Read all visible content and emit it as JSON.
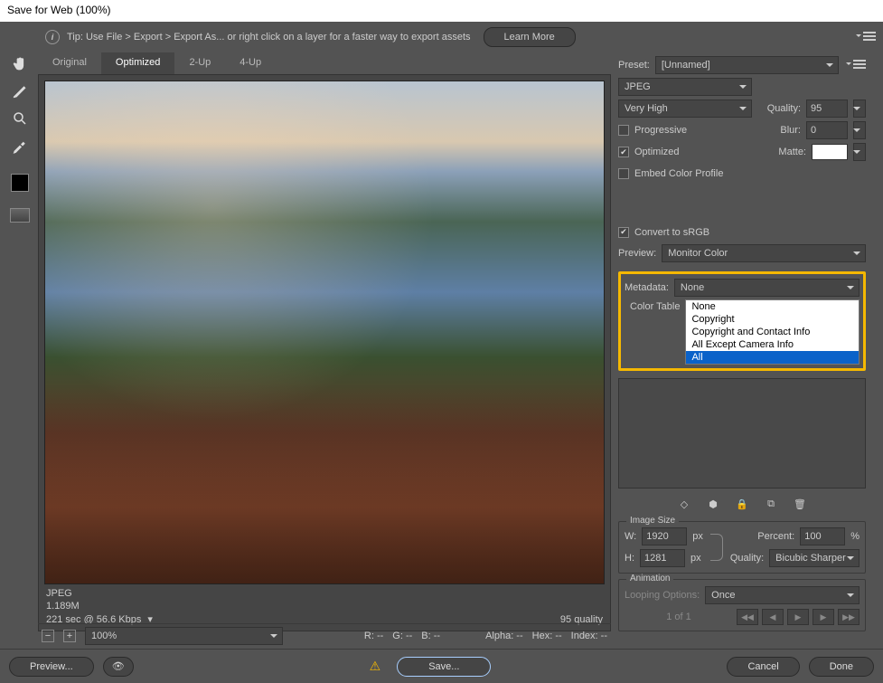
{
  "window": {
    "title": "Save for Web (100%)"
  },
  "tip": {
    "text": "Tip: Use File > Export > Export As...  or right click on a layer for a faster way to export assets",
    "learn": "Learn More"
  },
  "tabs": {
    "original": "Original",
    "optimized": "Optimized",
    "two_up": "2-Up",
    "four_up": "4-Up"
  },
  "preview_footer": {
    "format": "JPEG",
    "size": "1.189M",
    "time": "221 sec @ 56.6 Kbps",
    "quality": "95 quality"
  },
  "preset": {
    "label": "Preset:",
    "value": "[Unnamed]"
  },
  "format": {
    "value": "JPEG"
  },
  "compression": {
    "value": "Very High"
  },
  "quality": {
    "label": "Quality:",
    "value": "95"
  },
  "progressive": {
    "label": "Progressive"
  },
  "blur": {
    "label": "Blur:",
    "value": "0"
  },
  "optimized": {
    "label": "Optimized"
  },
  "matte": {
    "label": "Matte:"
  },
  "embed": {
    "label": "Embed Color Profile"
  },
  "convert": {
    "label": "Convert to sRGB"
  },
  "previewsel": {
    "label": "Preview:",
    "value": "Monitor Color"
  },
  "metadata": {
    "label": "Metadata:",
    "value": "None",
    "options": [
      "None",
      "Copyright",
      "Copyright and Contact Info",
      "All Except Camera Info",
      "All"
    ],
    "selected_index": 4
  },
  "color_table": {
    "label": "Color Table"
  },
  "image_size": {
    "title": "Image Size",
    "w_label": "W:",
    "w": "1920",
    "h_label": "H:",
    "h": "1281",
    "px": "px",
    "percent_label": "Percent:",
    "percent": "100",
    "pct_sym": "%",
    "quality_label": "Quality:",
    "quality": "Bicubic Sharper"
  },
  "animation": {
    "title": "Animation",
    "loop_label": "Looping Options:",
    "loop": "Once",
    "pages": "1 of 1"
  },
  "statusbar": {
    "zoom": "100%",
    "r": "R: --",
    "g": "G: --",
    "b": "B: --",
    "alpha": "Alpha: --",
    "hex": "Hex: --",
    "index": "Index: --"
  },
  "footer": {
    "preview": "Preview...",
    "save": "Save...",
    "cancel": "Cancel",
    "done": "Done"
  }
}
